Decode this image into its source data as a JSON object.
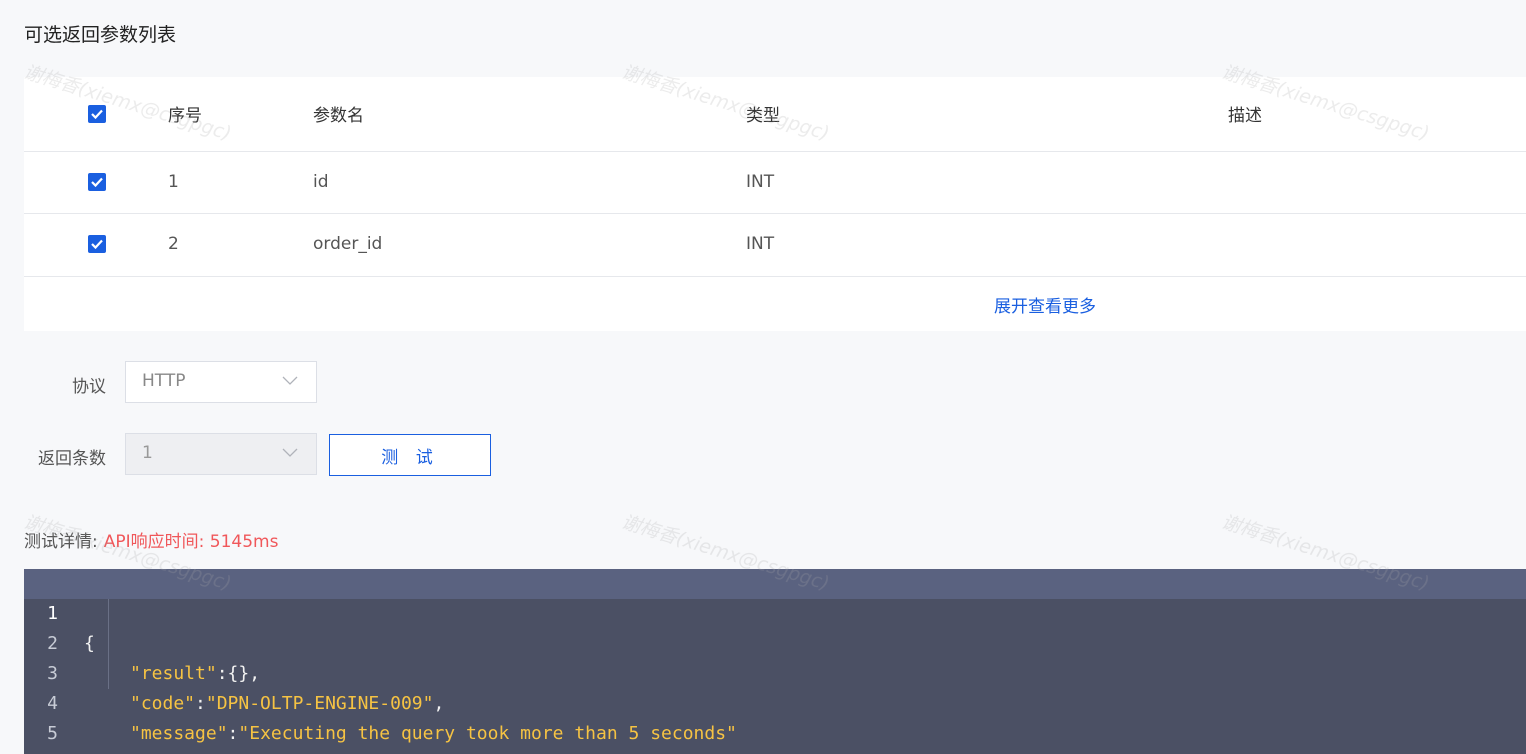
{
  "section_title": "可选返回参数列表",
  "table": {
    "headers": {
      "no": "序号",
      "name": "参数名",
      "type": "类型",
      "desc": "描述"
    },
    "rows": [
      {
        "no": "1",
        "name": "id",
        "type": "INT",
        "desc": ""
      },
      {
        "no": "2",
        "name": "order_id",
        "type": "INT",
        "desc": ""
      }
    ],
    "expand_label": "展开查看更多"
  },
  "form": {
    "protocol_label": "协议",
    "protocol_value": "HTTP",
    "count_label": "返回条数",
    "count_value": "1",
    "test_button": "测 试"
  },
  "test_detail": {
    "label": "测试详情:",
    "response_time": "API响应时间:  5145ms"
  },
  "code": {
    "lines": [
      "1",
      "2",
      "3",
      "4",
      "5"
    ],
    "open_brace": "{",
    "close_brace": "}",
    "result_key": "\"result\"",
    "result_val": "{}",
    "code_key": "\"code\"",
    "code_val": "\"DPN-OLTP-ENGINE-009\"",
    "message_key": "\"message\"",
    "message_val": "\"Executing the query took more than 5 seconds\""
  },
  "watermark": "谢梅香(xiemx@csgpgc)",
  "colors": {
    "accent": "#1a5fe0",
    "error": "#f0575a",
    "code_bg": "#4b5064",
    "code_string": "#f6c343"
  }
}
